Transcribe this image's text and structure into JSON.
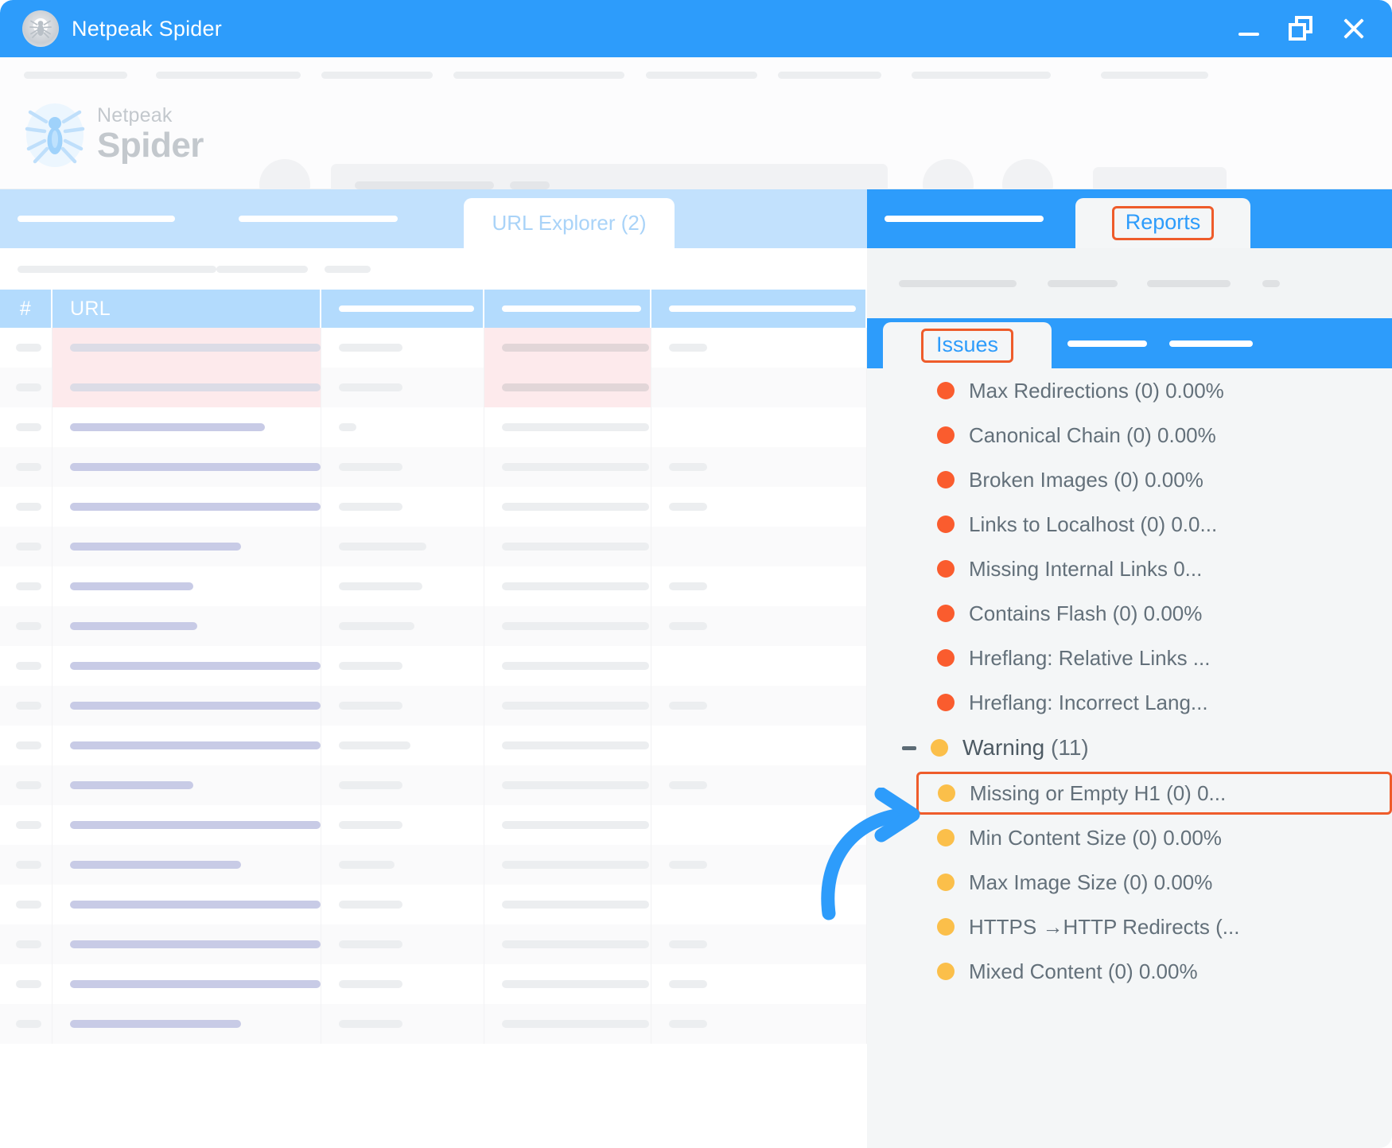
{
  "window": {
    "title": "Netpeak Spider",
    "logo_icon": "spider-icon",
    "controls": {
      "minimize": "minimize-icon",
      "restore": "restore-icon",
      "close": "close-icon"
    }
  },
  "brand": {
    "line1": "Netpeak",
    "line2": "Spider"
  },
  "left_pane": {
    "active_tab": "URL Explorer (2)",
    "table": {
      "columns": [
        "#",
        "URL",
        "",
        "",
        ""
      ],
      "rows": 18
    }
  },
  "right_pane": {
    "reports_tab": "Reports",
    "issues_tab": "Issues",
    "issues": [
      {
        "severity": "critical",
        "label": "Max Redirections (0) 0.00%"
      },
      {
        "severity": "critical",
        "label": "Canonical Chain (0) 0.00%"
      },
      {
        "severity": "critical",
        "label": "Broken Images (0) 0.00%"
      },
      {
        "severity": "critical",
        "label": "Links to Localhost (0) 0.0..."
      },
      {
        "severity": "critical",
        "label": "Missing Internal Links 0..."
      },
      {
        "severity": "critical",
        "label": "Contains Flash (0) 0.00%"
      },
      {
        "severity": "critical",
        "label": "Hreflang: Relative Links ..."
      },
      {
        "severity": "critical",
        "label": "Hreflang: Incorrect  Lang..."
      }
    ],
    "warning_group": {
      "collapse_state": "expanded",
      "severity": "warning",
      "title": "Warning",
      "count": "(11)"
    },
    "warnings": [
      {
        "severity": "warning",
        "label": "Missing or Empty H1 (0) 0...",
        "highlighted": true
      },
      {
        "severity": "warning",
        "label": "Min Content Size (0) 0.00%",
        "highlighted": false
      },
      {
        "severity": "warning",
        "label": "Max Image Size (0) 0.00%",
        "highlighted": false
      },
      {
        "severity": "warning",
        "label": "HTTPS →HTTP Redirects (...",
        "highlighted": false
      },
      {
        "severity": "warning",
        "label": "Mixed Content (0) 0.00%",
        "highlighted": false
      }
    ]
  },
  "colors": {
    "brand_blue": "#2d9cfb",
    "tab_blue_light": "#c2e1fd",
    "header_blue": "#b3dbfd",
    "highlight_orange": "#ee5c2b",
    "critical_red": "#fa5c2e",
    "warning_yellow": "#fbbf4a",
    "panel_gray": "#f4f6f7",
    "text_gray": "#63707a",
    "arrow_blue": "#2d9cfb"
  },
  "annotations": {
    "arrow": "curved-arrow-pointing-right"
  }
}
